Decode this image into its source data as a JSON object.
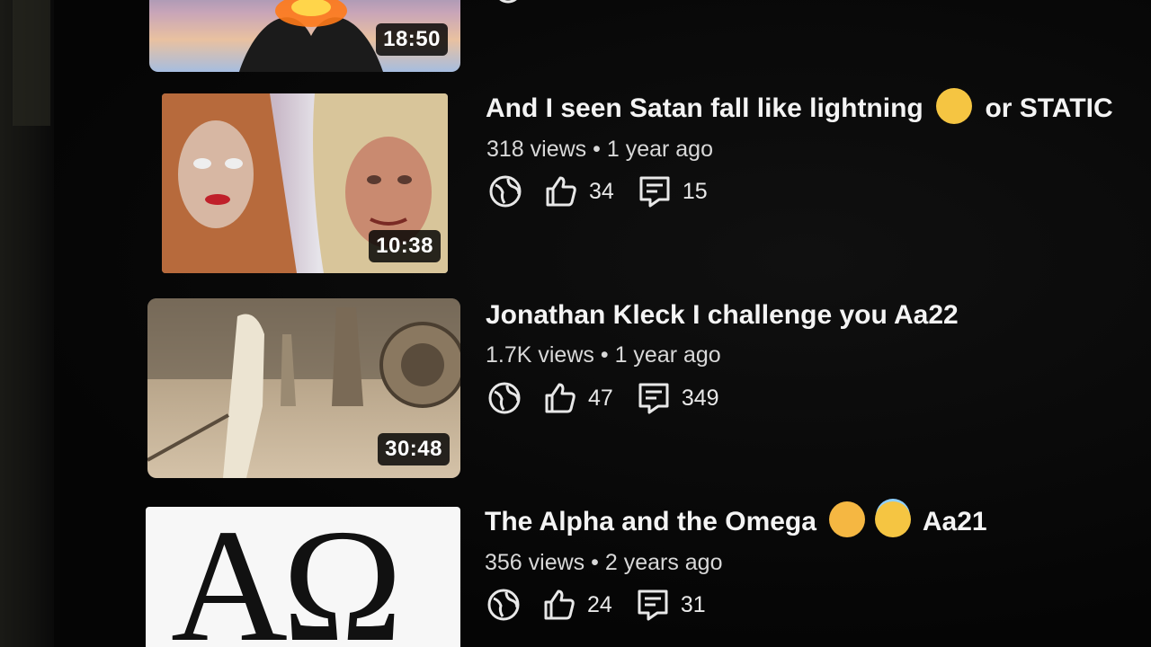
{
  "videos": [
    {
      "title": "",
      "duration": "18:50"
    },
    {
      "title_part1": "And I seen Satan fall like lightning",
      "title_part2": "or  STATIC",
      "views": "318 views",
      "separator": "•",
      "age": "1 year ago",
      "likes": "34",
      "comments": "15",
      "duration": "10:38"
    },
    {
      "title": "Jonathan Kleck  I challenge you  Aa22",
      "views": "1.7K views",
      "separator": "•",
      "age": "1 year ago",
      "likes": "47",
      "comments": "349",
      "duration": "30:48"
    },
    {
      "title_part1": "The Alpha and the Omega",
      "title_part2": "Aa21",
      "views": "356 views",
      "separator": "•",
      "age": "2 years ago",
      "likes": "24",
      "comments": "31",
      "thumb_text": "AΩ"
    }
  ],
  "icons": {
    "visibility": "globe-icon",
    "likes": "thumbs-up-icon",
    "comments": "comment-icon",
    "thinking_emoji": "thinking-face-emoji",
    "hearts_emoji": "smiling-face-with-hearts-emoji",
    "halo_emoji": "smiling-face-with-halo-emoji"
  },
  "colors": {
    "background": "#070707",
    "title": "#f4f4f4",
    "meta": "#d8d8d8",
    "emoji": "#f5c542"
  }
}
